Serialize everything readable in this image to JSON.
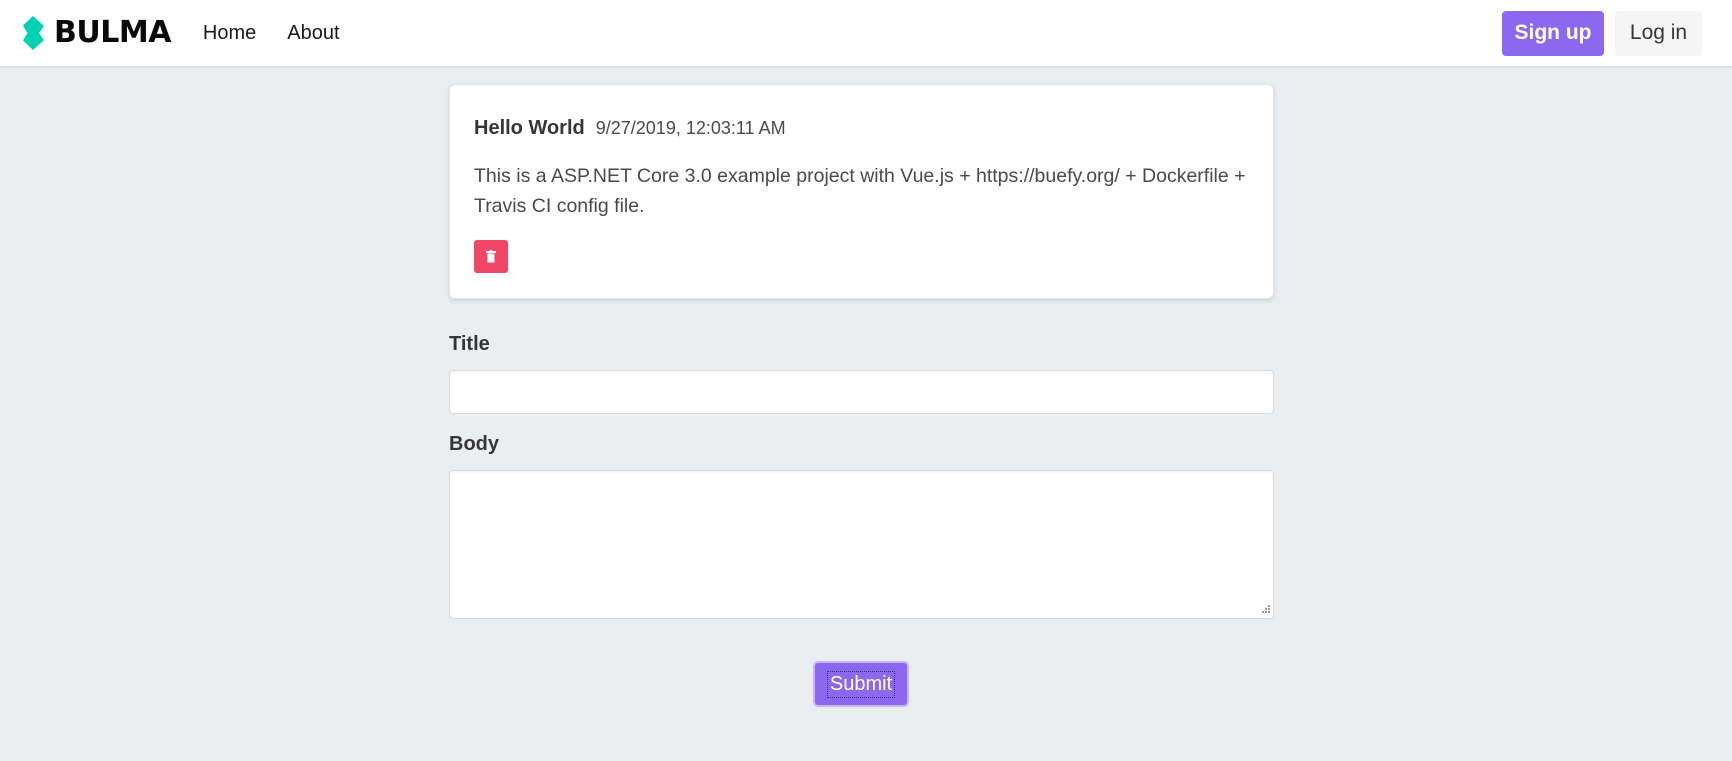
{
  "colors": {
    "brand_icon": "#00d1b2",
    "primary": "#8c67ef",
    "danger": "#f14668",
    "background": "#ebeef1"
  },
  "navbar": {
    "brand_text": "BULMA",
    "brand_icon": "bulma-logo-icon",
    "links": [
      "Home",
      "About"
    ],
    "signup_label": "Sign up",
    "login_label": "Log in"
  },
  "post": {
    "title": "Hello World",
    "date": "9/27/2019, 12:03:11 AM",
    "body": "This is a ASP.NET Core 3.0 example project with Vue.js + https://buefy.org/ + Dockerfile + Travis CI config file.",
    "delete_icon": "trash-icon"
  },
  "form": {
    "title_label": "Title",
    "title_value": "",
    "body_label": "Body",
    "body_value": "",
    "submit_label": "Submit"
  }
}
